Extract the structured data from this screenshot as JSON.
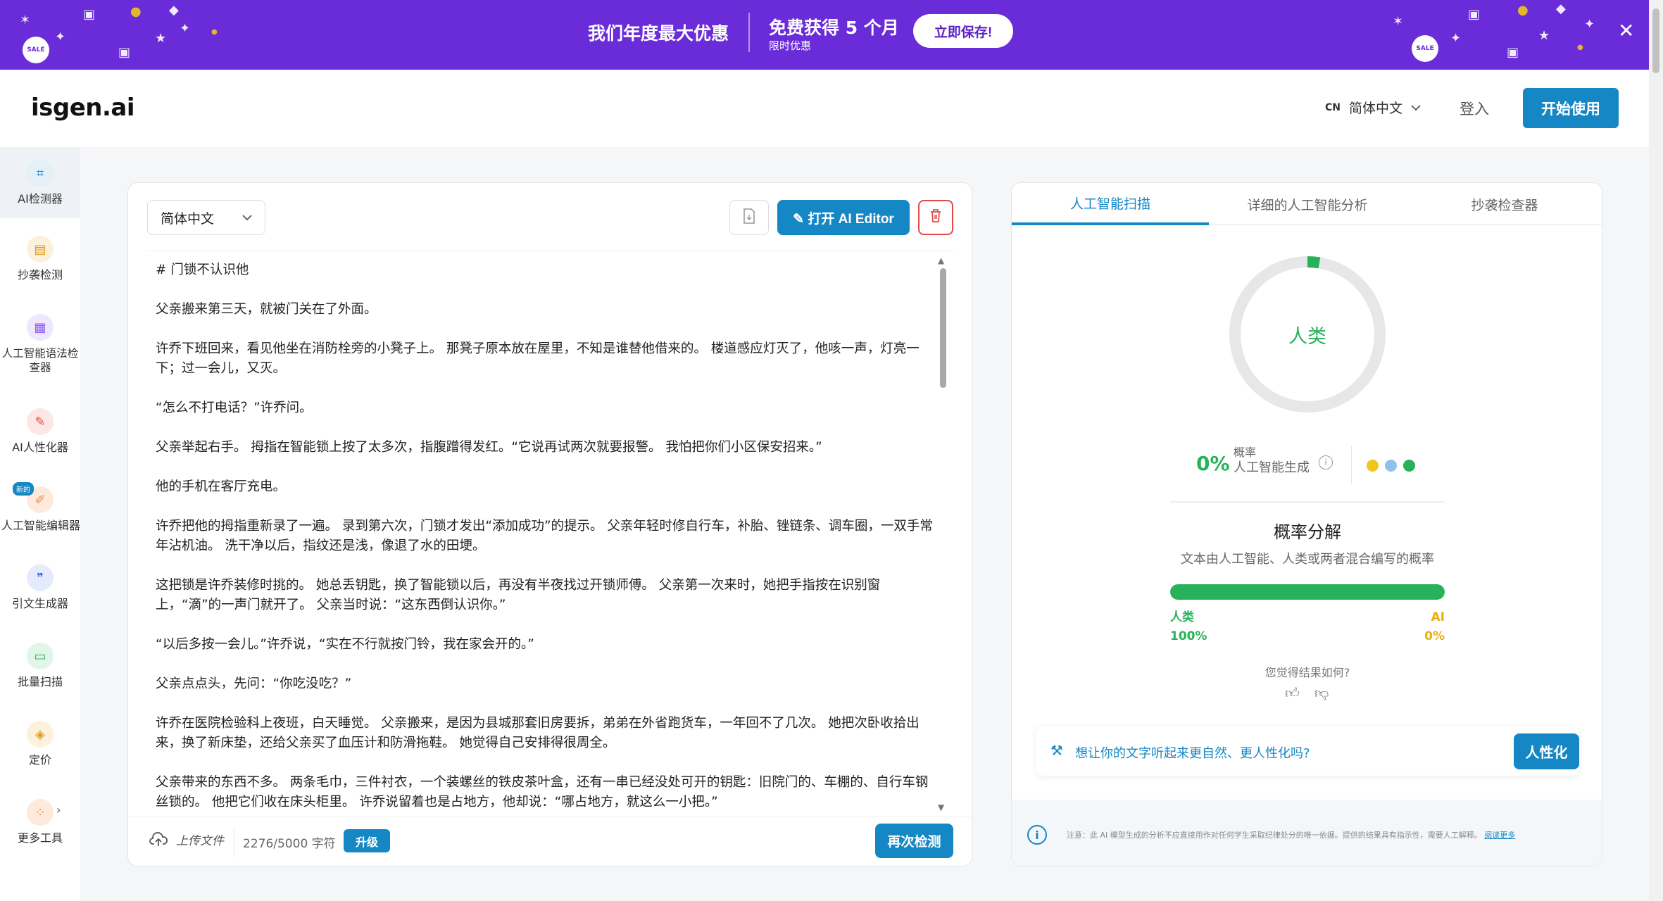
{
  "banner": {
    "title": "我们年度最大优惠",
    "offer": "免费获得 5 个月",
    "offer_sub": "限时优惠",
    "cta": "立即保存!",
    "sale_badge": "SALE"
  },
  "header": {
    "logo": "isgen.ai",
    "lang_code": "CN",
    "language": "简体中文",
    "login": "登入",
    "start": "开始使用"
  },
  "sidebar": {
    "items": [
      {
        "label": "AI检测器",
        "icon": "scan-icon",
        "color": "#1587c5"
      },
      {
        "label": "抄袭检测",
        "icon": "plagiarism-icon",
        "color": "#e09a1a"
      },
      {
        "label": "人工智能语法检查器",
        "icon": "grammar-icon",
        "color": "#8b5cf6"
      },
      {
        "label": "AI人性化器",
        "icon": "humanizer-icon",
        "color": "#e04b4b"
      },
      {
        "label": "人工智能编辑器",
        "icon": "editor-icon",
        "color": "#f08a3c",
        "badge": "新的"
      },
      {
        "label": "引文生成器",
        "icon": "quote-icon",
        "color": "#4a6fe0"
      },
      {
        "label": "批量扫描",
        "icon": "folder-icon",
        "color": "#27b25a"
      },
      {
        "label": "定价",
        "icon": "tag-icon",
        "color": "#e09a1a"
      },
      {
        "label": "更多工具",
        "icon": "grid-icon",
        "color": "#f08a3c"
      }
    ]
  },
  "editor": {
    "language": "简体中文",
    "ai_editor_button": "打开 AI Editor",
    "paragraphs": [
      "# 门锁不认识他",
      "父亲搬来第三天，就被门关在了外面。",
      "许乔下班回来，看见他坐在消防栓旁的小凳子上。 那凳子原本放在屋里，不知是谁替他借来的。 楼道感应灯灭了，他咳一声，灯亮一下；过一会儿，又灭。",
      "“怎么不打电话？”许乔问。",
      "父亲举起右手。 拇指在智能锁上按了太多次，指腹蹭得发红。“它说再试两次就要报警。 我怕把你们小区保安招来。”",
      "他的手机在客厅充电。",
      "许乔把他的拇指重新录了一遍。 录到第六次，门锁才发出“添加成功”的提示。 父亲年轻时修自行车，补胎、锉链条、调车圈，一双手常年沾机油。 洗干净以后，指纹还是浅，像退了水的田埂。",
      "这把锁是许乔装修时挑的。 她总丢钥匙，换了智能锁以后，再没有半夜找过开锁师傅。 父亲第一次来时，她把手指按在识别窗上，“滴”的一声门就开了。 父亲当时说：“这东西倒认识你。”",
      "“以后多按一会儿。”许乔说，“实在不行就按门铃，我在家会开的。”",
      "父亲点点头，先问：“你吃没吃？”",
      "许乔在医院检验科上夜班，白天睡觉。 父亲搬来，是因为县城那套旧房要拆，弟弟在外省跑货车，一年回不了几次。 她把次卧收拾出来，换了新床垫，还给父亲买了血压计和防滑拖鞋。 她觉得自己安排得很周全。",
      "父亲带来的东西不多。 两条毛巾，三件衬衣，一个装螺丝的铁皮茶叶盒，还有一串已经没处可开的钥匙：旧院门的、车棚的、自行车钢丝锁的。 他把它们收在床头柜里。 许乔说留着也是占地方，他却说：“哪占地方，就这么一小把。”"
    ],
    "upload_label": "上传文件",
    "char_count": "2276/5000 字符",
    "upgrade": "升级",
    "recheck": "再次检测"
  },
  "results": {
    "tabs": [
      "人工智能扫描",
      "详细的人工智能分析",
      "抄袭检查器"
    ],
    "verdict": "人类",
    "ai_probability": 0.0,
    "ai_percent_label": "0%",
    "prob_label_top": "概率",
    "prob_label_bottom": "人工智能生成",
    "legend_colors": [
      "#f2c51a",
      "#8fc0f0",
      "#27b25a"
    ],
    "breakdown_title": "概率分解",
    "breakdown_sub": "文本由人工智能、人类或两者混合编写的概率",
    "human_label": "人类",
    "human_percent": "100%",
    "human_fraction": 1.0,
    "ai_label": "AI",
    "ai_percent": "0%",
    "feedback_question": "您觉得结果如何?",
    "humanize_prompt": "想让你的文字听起来更自然、更人性化吗?",
    "humanize_button": "人性化",
    "note": "注意：此 AI 模型生成的分析不应直接用作对任何学生采取纪律处分的唯一依据。提供的结果具有指示性，需要人工解释。",
    "note_link": "阅读更多"
  },
  "colors": {
    "banner_purple": "#6a2bd9",
    "accent_blue": "#1587c5",
    "human_green": "#27b25a",
    "danger_red": "#e04b4b"
  }
}
